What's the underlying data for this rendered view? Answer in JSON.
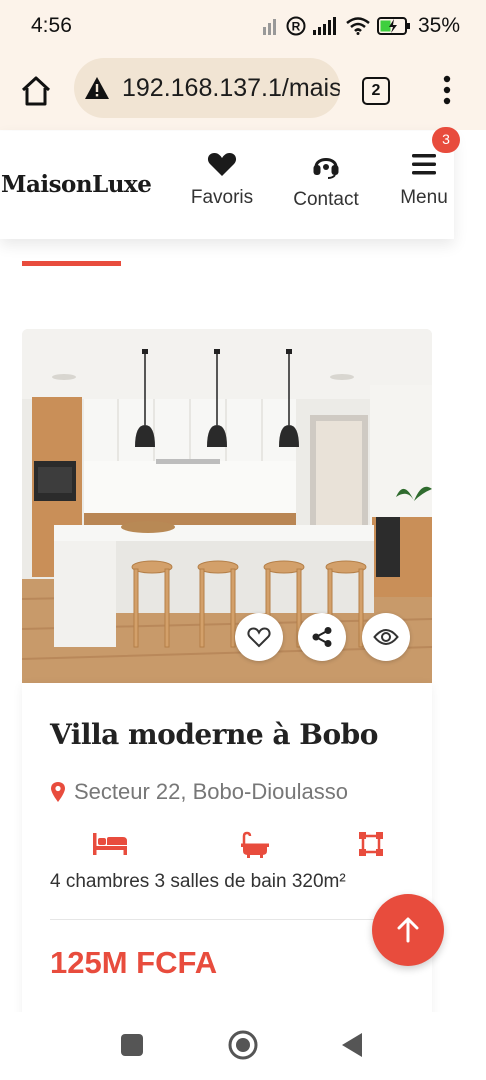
{
  "status_bar": {
    "time": "4:56",
    "battery": "35%"
  },
  "browser": {
    "url": "192.168.137.1/mais",
    "tab_count": "2"
  },
  "site": {
    "logo": "MaisonLuxe",
    "nav": [
      {
        "label": "Favoris",
        "icon": "heart-icon"
      },
      {
        "label": "Contact",
        "icon": "headset-icon"
      },
      {
        "label": "Menu",
        "icon": "hamburger-icon"
      }
    ],
    "menu_badge": "3",
    "accent_color": "#e84c3d"
  },
  "listing": {
    "title": "Villa moderne à Bobo",
    "location": "Secteur 22, Bobo-Dioulasso",
    "features": "4 chambres 3 salles de bain 320m²",
    "price": "125M FCFA",
    "image_actions": [
      "heart-icon",
      "share-icon",
      "eye-icon"
    ]
  }
}
